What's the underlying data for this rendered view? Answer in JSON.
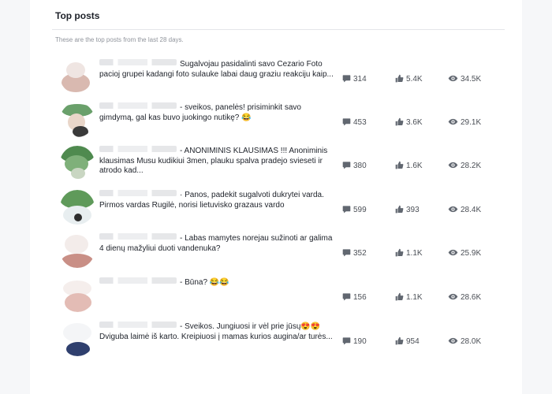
{
  "header": {
    "title": "Top posts",
    "subtitle": "These are the top posts from the last 28 days."
  },
  "posts": [
    {
      "text": "Sugalvojau pasidalinti savo Cezario Foto pacioj grupei kadangi foto sulauke labai daug graziu reakciju kaip...",
      "comments": "314",
      "likes": "5.4K",
      "views": "34.5K"
    },
    {
      "text": "- sveikos, panelės! prisiminkit savo gimdymą, gal kas buvo juokingo nutikę? 😂",
      "comments": "453",
      "likes": "3.6K",
      "views": "29.1K"
    },
    {
      "text": "- ANONIMINIS KLAUSIMAS !!! Anoniminis klausimas Musu kudikiui 3men, plauku spalva pradejo svieseti ir atrodo kad...",
      "comments": "380",
      "likes": "1.6K",
      "views": "28.2K"
    },
    {
      "text": "· Panos, padekit sugalvoti dukrytei varda. Pirmos vardas Rugilė, norisi lietuvisko grazaus vardo",
      "comments": "599",
      "likes": "393",
      "views": "28.4K"
    },
    {
      "text": "- Labas mamytes norejau sužinoti ar galima 4 dienų mažyliui duoti vandenuka?",
      "comments": "352",
      "likes": "1.1K",
      "views": "25.9K"
    },
    {
      "text": "- Būna? 😂😂",
      "comments": "156",
      "likes": "1.1K",
      "views": "28.6K"
    },
    {
      "text": "- Sveikos. Jungiuosi ir vėl prie jūsų😍😍 Dviguba laimė iš karto. Kreipiuosi į mamas kurios augina/ar turės...",
      "comments": "190",
      "likes": "954",
      "views": "28.0K"
    }
  ],
  "colors": {
    "text": "#1d2129",
    "muted": "#90949c",
    "icon": "#616770"
  },
  "icons": {
    "comments": "comment-bubble-icon",
    "likes": "thumbs-up-icon",
    "views": "eye-icon"
  }
}
